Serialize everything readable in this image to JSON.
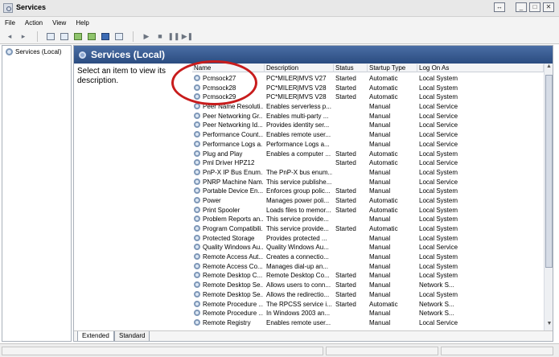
{
  "window": {
    "title": "Services",
    "buttons": [
      "↔",
      "_",
      "□",
      "✕"
    ]
  },
  "menubar": {
    "file": "File",
    "action": "Action",
    "view": "View",
    "help": "Help"
  },
  "toolbar": {
    "back": "◂",
    "forward": "▸",
    "play": "▶",
    "stop": "■",
    "pause": "❚❚",
    "restart": "▶❚"
  },
  "tree": {
    "root_label": "Services (Local)"
  },
  "main": {
    "header_title": "Services (Local)",
    "description_prompt": "Select an item to view its description.",
    "columns": {
      "name": "Name",
      "description": "Description",
      "status": "Status",
      "startup_type": "Startup Type",
      "log_on_as": "Log On As"
    },
    "services": [
      {
        "name": "Pcmsock27",
        "description": "PC*MILER|MVS V27",
        "status": "Started",
        "startup": "Automatic",
        "logon": "Local System"
      },
      {
        "name": "Pcmsock28",
        "description": "PC*MILER|MVS V28",
        "status": "Started",
        "startup": "Automatic",
        "logon": "Local System"
      },
      {
        "name": "Pcmsock29",
        "description": "PC*MILER|MVS V28",
        "status": "Started",
        "startup": "Automatic",
        "logon": "Local System"
      },
      {
        "name": "Peer Name Resoluti...",
        "description": "Enables serverless p...",
        "status": "",
        "startup": "Manual",
        "logon": "Local Service"
      },
      {
        "name": "Peer Networking Gr...",
        "description": "Enables multi-party ...",
        "status": "",
        "startup": "Manual",
        "logon": "Local Service"
      },
      {
        "name": "Peer Networking Id...",
        "description": "Provides identity ser...",
        "status": "",
        "startup": "Manual",
        "logon": "Local Service"
      },
      {
        "name": "Performance Count...",
        "description": "Enables remote user...",
        "status": "",
        "startup": "Manual",
        "logon": "Local Service"
      },
      {
        "name": "Performance Logs a...",
        "description": "Performance Logs a...",
        "status": "",
        "startup": "Manual",
        "logon": "Local Service"
      },
      {
        "name": "Plug and Play",
        "description": "Enables a computer ...",
        "status": "Started",
        "startup": "Automatic",
        "logon": "Local System"
      },
      {
        "name": "Pml Driver HPZ12",
        "description": "",
        "status": "Started",
        "startup": "Automatic",
        "logon": "Local Service"
      },
      {
        "name": "PnP-X IP Bus Enum...",
        "description": "The PnP-X bus enum...",
        "status": "",
        "startup": "Manual",
        "logon": "Local System"
      },
      {
        "name": "PNRP Machine Nam...",
        "description": "This service publishe...",
        "status": "",
        "startup": "Manual",
        "logon": "Local Service"
      },
      {
        "name": "Portable Device En...",
        "description": "Enforces group polic...",
        "status": "Started",
        "startup": "Manual",
        "logon": "Local System"
      },
      {
        "name": "Power",
        "description": "Manages power poli...",
        "status": "Started",
        "startup": "Automatic",
        "logon": "Local System"
      },
      {
        "name": "Print Spooler",
        "description": "Loads files to memor...",
        "status": "Started",
        "startup": "Automatic",
        "logon": "Local System"
      },
      {
        "name": "Problem Reports an...",
        "description": "This service provide...",
        "status": "",
        "startup": "Manual",
        "logon": "Local System"
      },
      {
        "name": "Program Compatibili...",
        "description": "This service provide...",
        "status": "Started",
        "startup": "Automatic",
        "logon": "Local System"
      },
      {
        "name": "Protected Storage",
        "description": "Provides protected ...",
        "status": "",
        "startup": "Manual",
        "logon": "Local System"
      },
      {
        "name": "Quality Windows Au...",
        "description": "Quality Windows Au...",
        "status": "",
        "startup": "Manual",
        "logon": "Local Service"
      },
      {
        "name": "Remote Access Aut...",
        "description": "Creates a connectio...",
        "status": "",
        "startup": "Manual",
        "logon": "Local System"
      },
      {
        "name": "Remote Access Co...",
        "description": "Manages dial-up an...",
        "status": "",
        "startup": "Manual",
        "logon": "Local System"
      },
      {
        "name": "Remote Desktop C...",
        "description": "Remote Desktop Co...",
        "status": "Started",
        "startup": "Manual",
        "logon": "Local System"
      },
      {
        "name": "Remote Desktop Se...",
        "description": "Allows users to conn...",
        "status": "Started",
        "startup": "Manual",
        "logon": "Network S..."
      },
      {
        "name": "Remote Desktop Se...",
        "description": "Allows the redirectio...",
        "status": "Started",
        "startup": "Manual",
        "logon": "Local System"
      },
      {
        "name": "Remote Procedure ...",
        "description": "The RPCSS service i...",
        "status": "Started",
        "startup": "Automatic",
        "logon": "Network S..."
      },
      {
        "name": "Remote Procedure ...",
        "description": "In Windows 2003 an...",
        "status": "",
        "startup": "Manual",
        "logon": "Network S..."
      },
      {
        "name": "Remote Registry",
        "description": "Enables remote user...",
        "status": "",
        "startup": "Manual",
        "logon": "Local Service"
      }
    ]
  },
  "tabs": {
    "extended": "Extended",
    "standard": "Standard"
  },
  "colors": {
    "header_blue": "#2b4c80",
    "annotation_red": "#c81c1c"
  }
}
